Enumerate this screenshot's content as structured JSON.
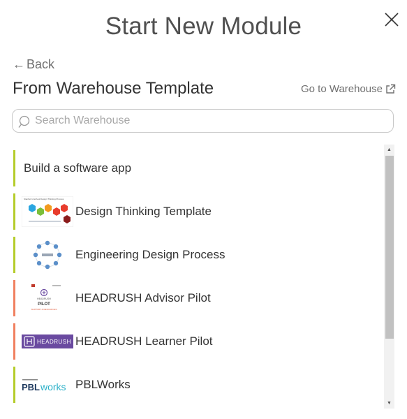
{
  "header": {
    "title": "Start New Module",
    "close_icon": "close-icon"
  },
  "nav": {
    "back_label": "Back"
  },
  "section": {
    "title": "From Warehouse Template",
    "warehouse_link": "Go to Warehouse"
  },
  "search": {
    "placeholder": "Search Warehouse",
    "value": ""
  },
  "templates": [
    {
      "label": "Build a software app",
      "accent": "#b5cc2b",
      "thumbnail": "none"
    },
    {
      "label": "Design Thinking Template",
      "accent": "#b5cc2b",
      "thumbnail": "design-thinking-diagram"
    },
    {
      "label": "Engineering Design Process",
      "accent": "#b5cc2b",
      "thumbnail": "engineering-cycle-diagram"
    },
    {
      "label": "HEADRUSH Advisor Pilot",
      "accent": "#f08060",
      "thumbnail": "headrush-pilot-logo"
    },
    {
      "label": "HEADRUSH Learner Pilot",
      "accent": "#f08060",
      "thumbnail": "headrush-banner-logo"
    },
    {
      "label": "PBLWorks",
      "accent": "#b5cc2b",
      "thumbnail": "pblworks-logo"
    }
  ],
  "thumb_text": {
    "design_title": "Stanford d.school Design Thinking Process",
    "headrush_pilot": "PILOT",
    "headrush_small": "HEADRUSH",
    "headrush_support": "SUPPORT & RESOURCES",
    "headrush_banner": "HEADRUSH",
    "pbl_pre": "PBL",
    "pbl_works": "works"
  },
  "colors": {
    "accent_green": "#b5cc2b",
    "accent_orange": "#f08060",
    "headrush_purple": "#6a4aa0"
  }
}
